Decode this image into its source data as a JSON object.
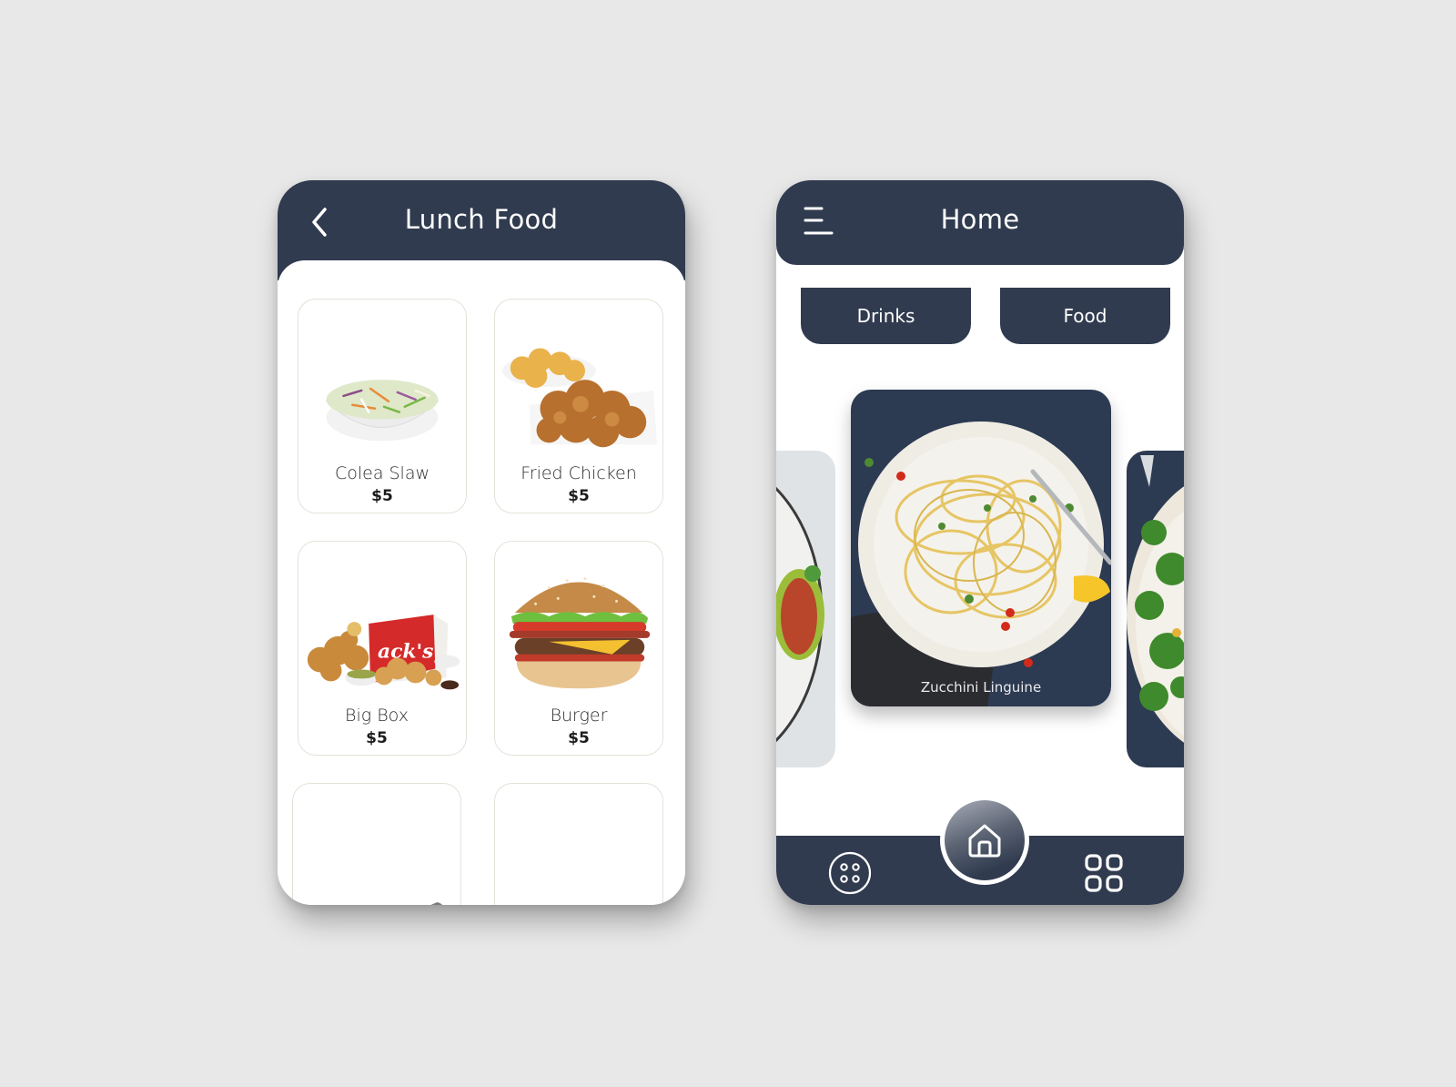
{
  "colors": {
    "background": "#e8e8e8",
    "primary_navy": "#303b4f",
    "card_border": "#e4e2d8",
    "white": "#ffffff"
  },
  "lunch_screen": {
    "title": "Lunch Food",
    "back_icon": "chevron-left-icon",
    "items": [
      {
        "name": "Colea Slaw",
        "price": "$5",
        "image": "coleslaw-bowl"
      },
      {
        "name": "Fried Chicken",
        "price": "$5",
        "image": "fried-chicken-platter"
      },
      {
        "name": "Big Box",
        "price": "$5",
        "image": "big-box-meal"
      },
      {
        "name": "Burger",
        "price": "$5",
        "image": "cheeseburger"
      },
      {
        "name": "",
        "price": "",
        "image": "chocolate-ice-cream-scoop"
      },
      {
        "name": "",
        "price": "",
        "image": "breakfast-plate"
      }
    ]
  },
  "home_screen": {
    "title": "Home",
    "menu_icon": "hamburger-menu-icon",
    "categories": [
      "Drinks",
      "Food"
    ],
    "carousel": {
      "active": {
        "caption": "Zucchini Linguine",
        "image": "zucchini-linguine-plate"
      },
      "previous": {
        "image": "stuffed-zucchini-plate"
      },
      "next": {
        "image": "herb-rice-bowl"
      }
    },
    "bottom_nav": {
      "left_icon": "dots-circle-icon",
      "center_icon": "home-icon",
      "right_icon": "grid-icon"
    }
  }
}
